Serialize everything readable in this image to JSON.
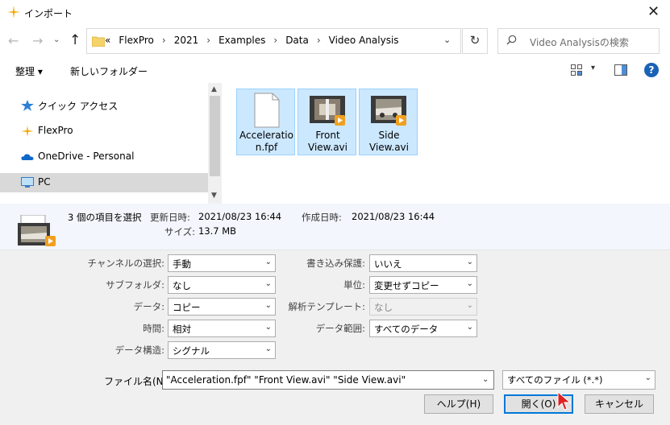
{
  "window": {
    "title": "インポート",
    "close": "✕"
  },
  "nav": {
    "back": "←",
    "forward": "→",
    "recent": "⌄",
    "up": "↑",
    "breadcrumbs": [
      "«",
      "FlexPro",
      "›",
      "2021",
      "›",
      "Examples",
      "›",
      "Data",
      "›",
      "Video Analysis"
    ],
    "address_dropdown": "⌄",
    "refresh": "↻",
    "search_placeholder": "Video Analysisの検索"
  },
  "toolbar": {
    "organize": "整理 ▾",
    "new_folder": "新しいフォルダー",
    "view_dropdown": "▾",
    "help": "?"
  },
  "sidebar": {
    "items": [
      {
        "label": "クイック アクセス",
        "icon": "star-icon"
      },
      {
        "label": "FlexPro",
        "icon": "flexpro-icon"
      },
      {
        "label": "OneDrive - Personal",
        "icon": "cloud-icon"
      },
      {
        "label": "PC",
        "icon": "pc-icon"
      }
    ]
  },
  "files": [
    {
      "name": "Acceleration.fpf",
      "icon": "document-icon"
    },
    {
      "name": "Front View.avi",
      "icon": "video-icon"
    },
    {
      "name": "Side View.avi",
      "icon": "video-icon"
    }
  ],
  "details": {
    "selection": "3 個の項目を選択",
    "modified_label": "更新日時:",
    "modified_value": "2021/08/23 16:44",
    "created_label": "作成日時:",
    "created_value": "2021/08/23 16:44",
    "size_label": "サイズ:",
    "size_value": "13.7 MB"
  },
  "options": {
    "channel_label": "チャンネルの選択:",
    "channel_value": "手動",
    "subfolder_label": "サブフォルダ:",
    "subfolder_value": "なし",
    "data_label": "データ:",
    "data_value": "コピー",
    "time_label": "時間:",
    "time_value": "相対",
    "datastruct_label": "データ構造:",
    "datastruct_value": "シグナル",
    "writeprotect_label": "書き込み保護:",
    "writeprotect_value": "いいえ",
    "unit_label": "単位:",
    "unit_value": "変更せずコピー",
    "template_label": "解析テンプレート:",
    "template_value": "なし",
    "range_label": "データ範囲:",
    "range_value": "すべてのデータ"
  },
  "filename": {
    "label": "ファイル名(N):",
    "value": "\"Acceleration.fpf\" \"Front View.avi\" \"Side View.avi\"",
    "filetype": "すべてのファイル (*.*)"
  },
  "buttons": {
    "help": "ヘルプ(H)",
    "open": "開く(O)",
    "cancel": "キャンセル"
  },
  "colors": {
    "accent": "#0078d7",
    "selection_bg": "#cce8ff",
    "selection_border": "#99d1ff",
    "options_bg": "#f0f0f0",
    "details_bg": "#f3f6fc"
  }
}
